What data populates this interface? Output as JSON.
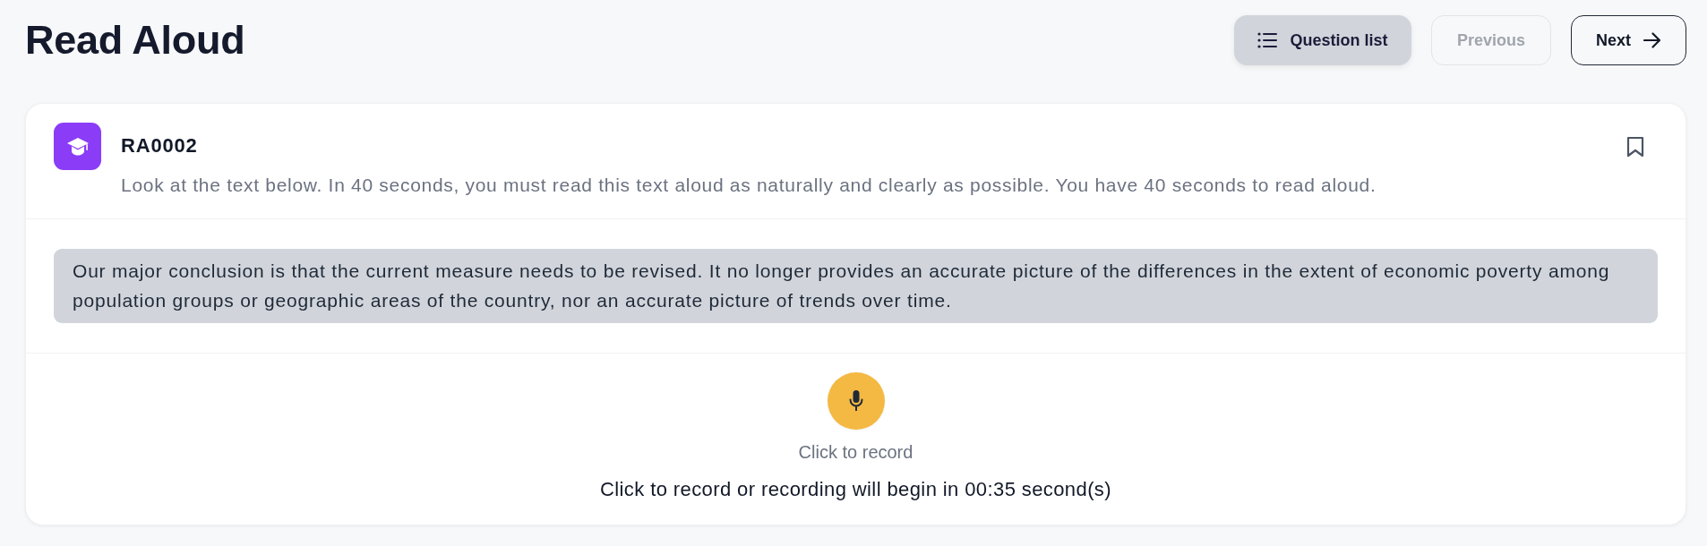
{
  "page": {
    "title": "Read Aloud"
  },
  "toolbar": {
    "buttons": [
      {
        "kind": "list",
        "label": "Question list",
        "disabled": false
      },
      {
        "kind": "previous",
        "label": "Previous",
        "disabled": true
      },
      {
        "kind": "next",
        "label": "Next",
        "disabled": false
      }
    ]
  },
  "question": {
    "code": "RA0002",
    "instruction": "Look at the text below. In 40 seconds, you must read this text aloud as naturally and clearly as possible. You have 40 seconds to read aloud.",
    "bookmarked": false,
    "passage": "Our major conclusion is that the current measure needs to be revised. It no longer provides an accurate picture of the differences in the extent of economic poverty among population groups or geographic areas of the country, nor an accurate picture of trends over time."
  },
  "recorder": {
    "label": "Click to record",
    "status": "Click to record or recording will begin in 00:35 second(s)"
  }
}
